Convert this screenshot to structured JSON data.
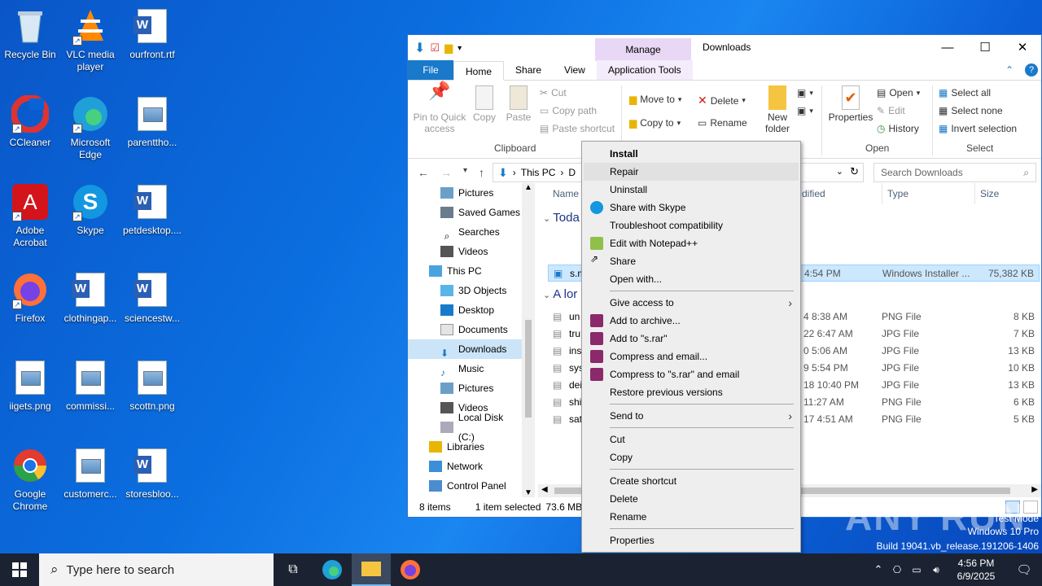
{
  "desktop": {
    "icons": [
      {
        "label": "Recycle Bin",
        "icon": "recycle-bin-icon"
      },
      {
        "label": "VLC media player",
        "icon": "vlc-icon"
      },
      {
        "label": "ourfront.rtf",
        "icon": "word-document-icon"
      },
      {
        "label": "CCleaner",
        "icon": "ccleaner-icon"
      },
      {
        "label": "Microsoft Edge",
        "icon": "edge-icon"
      },
      {
        "label": "parenttho...",
        "icon": "image-file-icon"
      },
      {
        "label": "Adobe Acrobat",
        "icon": "acrobat-icon"
      },
      {
        "label": "Skype",
        "icon": "skype-icon"
      },
      {
        "label": "petdesktop....",
        "icon": "word-document-icon"
      },
      {
        "label": "Firefox",
        "icon": "firefox-icon"
      },
      {
        "label": "clothingap...",
        "icon": "word-document-icon"
      },
      {
        "label": "sciencestw...",
        "icon": "word-document-icon"
      },
      {
        "label": "iigets.png",
        "icon": "image-file-icon"
      },
      {
        "label": "commissi...",
        "icon": "image-file-icon"
      },
      {
        "label": "scottn.png",
        "icon": "image-file-icon"
      },
      {
        "label": "Google Chrome",
        "icon": "chrome-icon"
      },
      {
        "label": "customerc...",
        "icon": "image-file-icon"
      },
      {
        "label": "storesbloo...",
        "icon": "word-document-icon"
      }
    ]
  },
  "explorer": {
    "title": "Downloads",
    "manage_tab": "Manage",
    "tabs": {
      "file": "File",
      "home": "Home",
      "share": "Share",
      "view": "View",
      "apptools": "Application Tools"
    },
    "ribbon": {
      "pin": "Pin to Quick access",
      "copy": "Copy",
      "paste": "Paste",
      "cut": "Cut",
      "copy_path": "Copy path",
      "paste_shortcut": "Paste shortcut",
      "clipboard_group": "Clipboard",
      "move_to": "Move to",
      "copy_to": "Copy to",
      "delete": "Delete",
      "rename": "Rename",
      "new_folder": "New folder",
      "properties": "Properties",
      "open": "Open",
      "edit": "Edit",
      "history": "History",
      "open_group": "Open",
      "select_all": "Select all",
      "select_none": "Select none",
      "invert_selection": "Invert selection",
      "select_group": "Select"
    },
    "address": {
      "this_pc": "This PC",
      "crumb_d": "D",
      "search_placeholder": "Search Downloads"
    },
    "nav_items": [
      {
        "label": "Pictures"
      },
      {
        "label": "Saved Games"
      },
      {
        "label": "Searches"
      },
      {
        "label": "Videos"
      },
      {
        "label": "This PC"
      },
      {
        "label": "3D Objects"
      },
      {
        "label": "Desktop"
      },
      {
        "label": "Documents"
      },
      {
        "label": "Downloads"
      },
      {
        "label": "Music"
      },
      {
        "label": "Pictures"
      },
      {
        "label": "Videos"
      },
      {
        "label": "Local Disk (C:)"
      },
      {
        "label": "Libraries"
      },
      {
        "label": "Network"
      },
      {
        "label": "Control Panel"
      }
    ],
    "columns": {
      "name": "Name",
      "modified": "dified",
      "type": "Type",
      "size": "Size"
    },
    "groups": {
      "today": "Toda",
      "long_ago": "A lor"
    },
    "files_today": [
      {
        "name": "s.m",
        "date": "4:54 PM",
        "type": "Windows Installer ...",
        "size": "75,382 KB"
      }
    ],
    "files_old": [
      {
        "name": "un",
        "date": "4 8:38 AM",
        "type": "PNG File",
        "size": "8 KB"
      },
      {
        "name": "tru",
        "date": "22 6:47 AM",
        "type": "JPG File",
        "size": "7 KB"
      },
      {
        "name": "ins",
        "date": "0 5:06 AM",
        "type": "JPG File",
        "size": "13 KB"
      },
      {
        "name": "sys",
        "date": "9 5:54 PM",
        "type": "JPG File",
        "size": "10 KB"
      },
      {
        "name": "dei",
        "date": "18 10:40 PM",
        "type": "JPG File",
        "size": "13 KB"
      },
      {
        "name": "shi",
        "date": "11:27 AM",
        "type": "PNG File",
        "size": "6 KB"
      },
      {
        "name": "sat",
        "date": "17 4:51 AM",
        "type": "PNG File",
        "size": "5 KB"
      }
    ],
    "status": {
      "items": "8 items",
      "selected": "1 item selected",
      "size": "73.6 MB"
    }
  },
  "context_menu": {
    "items": [
      {
        "label": "Install",
        "bold": true
      },
      {
        "label": "Repair"
      },
      {
        "label": "Uninstall"
      },
      {
        "label": "Share with Skype",
        "icon": "skype-icon"
      },
      {
        "label": "Troubleshoot compatibility"
      },
      {
        "label": "Edit with Notepad++",
        "icon": "notepad-plus-icon"
      },
      {
        "label": "Share",
        "icon": "share-icon"
      },
      {
        "label": "Open with..."
      },
      {
        "label": "Give access to",
        "submenu": true
      },
      {
        "label": "Add to archive...",
        "icon": "winrar-icon"
      },
      {
        "label": "Add to \"s.rar\"",
        "icon": "winrar-icon"
      },
      {
        "label": "Compress and email...",
        "icon": "winrar-icon"
      },
      {
        "label": "Compress to \"s.rar\" and email",
        "icon": "winrar-icon"
      },
      {
        "label": "Restore previous versions"
      },
      {
        "label": "Send to",
        "submenu": true
      },
      {
        "label": "Cut"
      },
      {
        "label": "Copy"
      },
      {
        "label": "Create shortcut"
      },
      {
        "label": "Delete"
      },
      {
        "label": "Rename"
      },
      {
        "label": "Properties"
      }
    ]
  },
  "taskbar": {
    "search_placeholder": "Type here to search",
    "time": "4:56 PM",
    "date": "6/9/2025"
  },
  "watermark": {
    "line1": "Test Mode",
    "line2": "Windows 10 Pro",
    "line3": "Build 19041.vb_release.191206-1406",
    "brand": "ANY RUN"
  },
  "colors": {
    "accent": "#1979ca",
    "selection": "#cce8ff",
    "manage": "#e9d8f5",
    "taskbar": "#1b2332"
  }
}
